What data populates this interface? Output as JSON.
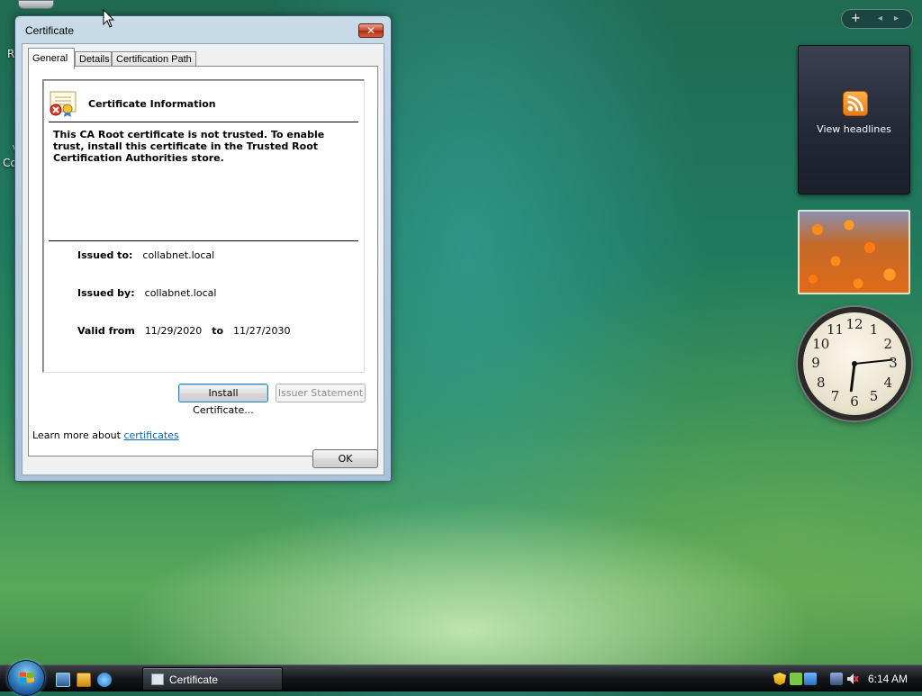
{
  "desktop": {
    "icon_fragments": [
      "R",
      "\\",
      "Cc"
    ]
  },
  "window": {
    "title": "Certificate",
    "close_glyph": "✕",
    "tabs": [
      {
        "label": "General",
        "active": true
      },
      {
        "label": "Details",
        "active": false
      },
      {
        "label": "Certification Path",
        "active": false
      }
    ],
    "info": {
      "header": "Certificate Information",
      "warning": "This CA Root certificate is not trusted. To enable trust, install this certificate in the Trusted Root Certification Authorities store.",
      "issued_to_label": "Issued to:",
      "issued_to": "collabnet.local",
      "issued_by_label": "Issued by:",
      "issued_by": "collabnet.local",
      "valid_from_label": "Valid from",
      "valid_from": "11/29/2020",
      "valid_to_label": "to",
      "valid_to": "11/27/2030"
    },
    "install_button": "Install Certificate...",
    "issuer_statement_button": "Issuer Statement",
    "learn_more_prefix": "Learn more about ",
    "learn_more_link": "certificates",
    "ok_button": "OK"
  },
  "sidebar": {
    "add_glyph": "+",
    "prev_glyph": "◂",
    "next_glyph": "▸",
    "feed_label": "View headlines",
    "clock_numbers": [
      "12",
      "1",
      "2",
      "3",
      "4",
      "5",
      "6",
      "7",
      "8",
      "9",
      "10",
      "11"
    ],
    "clock_time": "6:14"
  },
  "taskbar": {
    "task_label": "Certificate",
    "clock": "6:14 AM"
  },
  "colors": {
    "link": "#0066cc",
    "close_red": "#c8452b",
    "rss_orange": "#ec7a12"
  }
}
